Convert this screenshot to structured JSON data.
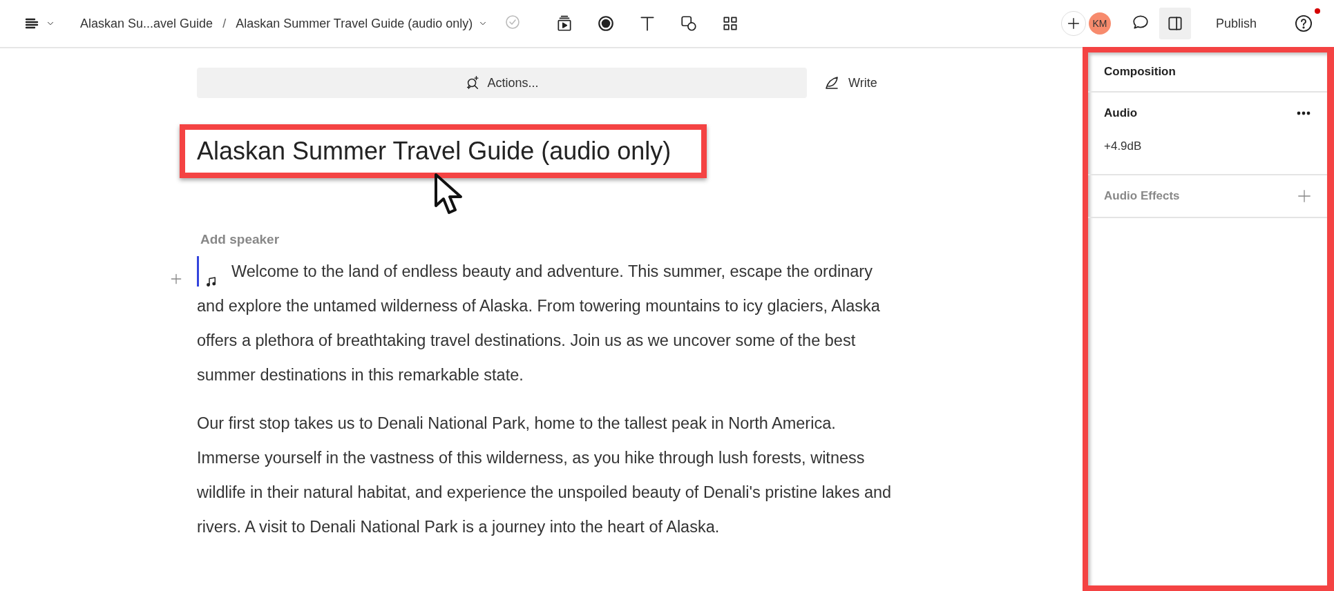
{
  "toolbar": {
    "breadcrumb_separator": "/",
    "breadcrumbs": [
      {
        "label": "Alaskan Su...avel Guide"
      },
      {
        "label": "Alaskan Summer Travel Guide (audio only)"
      }
    ],
    "avatar": {
      "initials": "KM"
    },
    "sidebar_toggle": {
      "selected": true
    },
    "publish": "Publish",
    "help": {
      "notification": true
    }
  },
  "actions": {
    "label": "Actions...",
    "write": "Write"
  },
  "document": {
    "title": "Alaskan Summer Travel Guide (audio only)",
    "speaker_placeholder": "Add speaker",
    "paragraphs": [
      {
        "text": "Welcome to the land of endless beauty and adventure.  This summer, escape the ordinary and explore the untamed wilderness of Alaska.  From towering mountains to icy glaciers, Alaska offers a plethora of breathtaking travel destinations.  Join us as we uncover some of the best summer destinations in this remarkable state.",
        "active": true
      },
      {
        "text": "Our first stop takes us to Denali National Park, home to the tallest peak in North America.  Immerse yourself in the vastness of this wilderness, as you hike through lush forests, witness wildlife in their natural habitat, and experience the unspoiled beauty of Denali's pristine lakes and rivers. A visit to Denali National Park is a journey into the heart of Alaska.",
        "active": false
      }
    ]
  },
  "panel": {
    "title": "Composition",
    "sections": [
      {
        "kind": "audio",
        "title": "Audio",
        "value": "+4.9dB"
      },
      {
        "kind": "effects",
        "title": "Audio Effects"
      }
    ]
  }
}
